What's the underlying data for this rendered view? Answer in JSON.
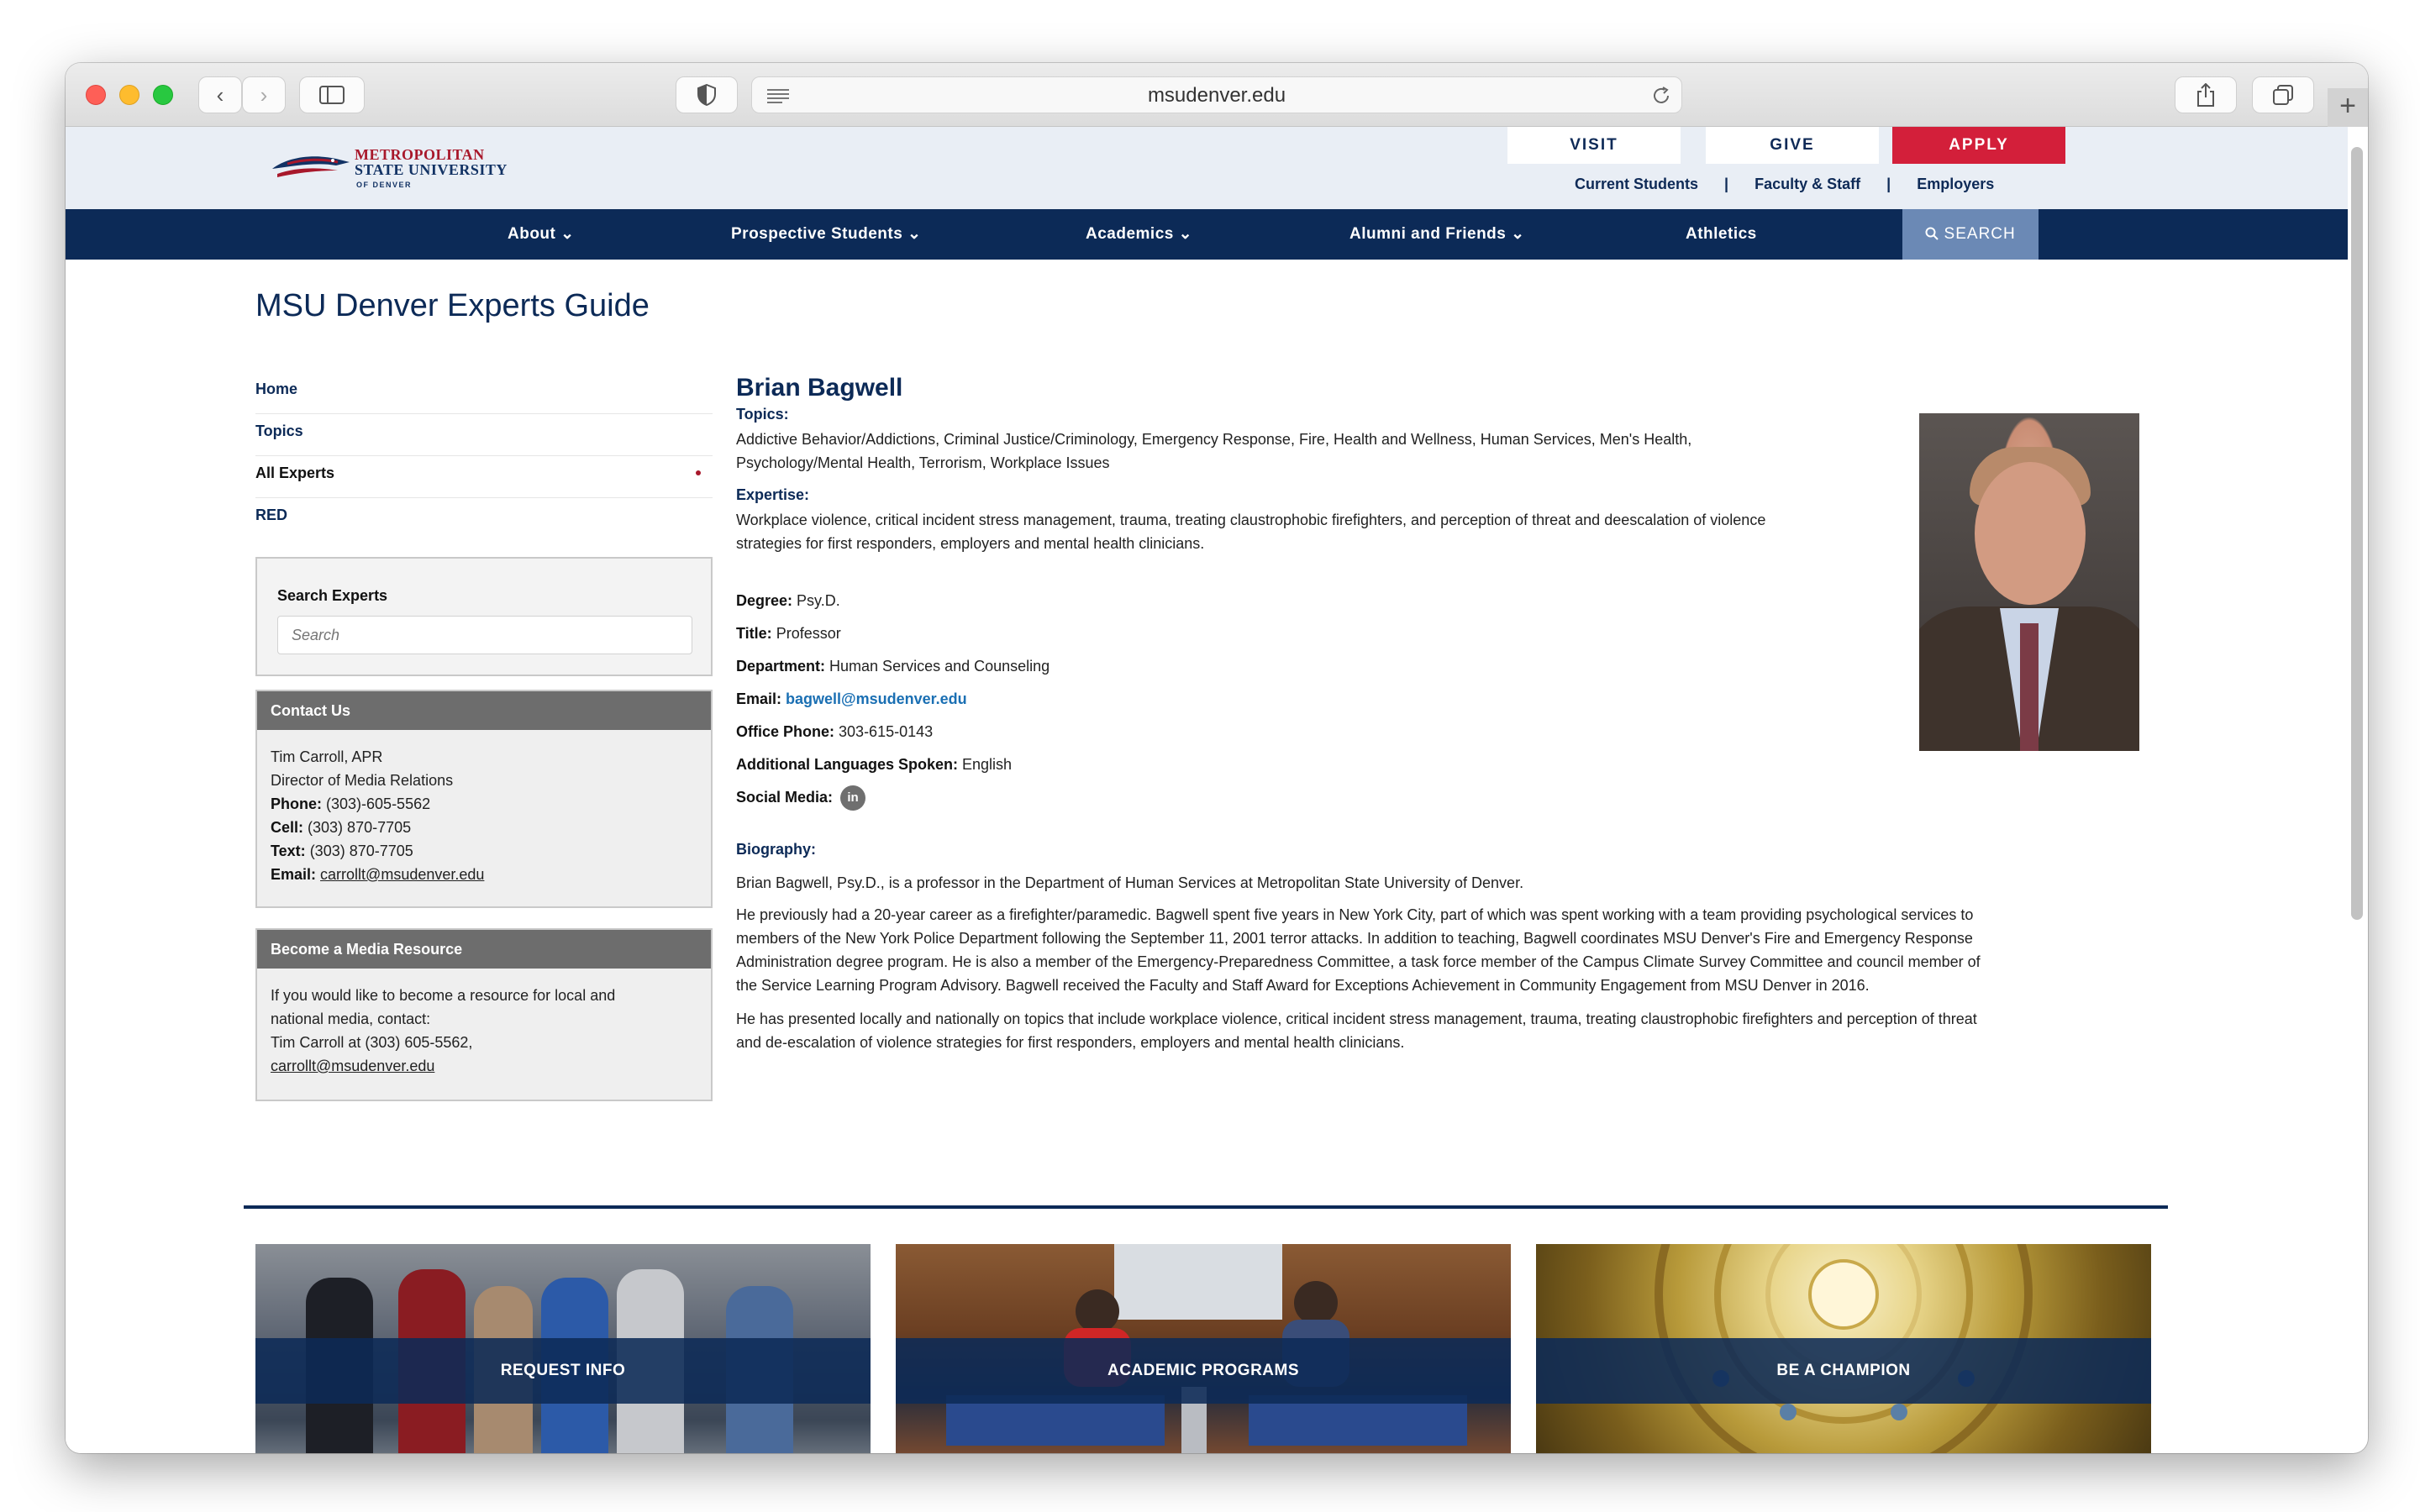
{
  "browser": {
    "url": "msudenver.edu"
  },
  "logo": {
    "line1": "Metropolitan",
    "line2": "State University",
    "line3": "of Denver"
  },
  "topbar": {
    "buttons": [
      {
        "label": "VISIT"
      },
      {
        "label": "GIVE"
      },
      {
        "label": "APPLY"
      }
    ],
    "links": [
      "Current Students",
      "Faculty & Staff",
      "Employers"
    ],
    "separator": "|"
  },
  "nav": {
    "items": [
      {
        "label": "About ⌄"
      },
      {
        "label": "Prospective Students ⌄"
      },
      {
        "label": "Academics ⌄"
      },
      {
        "label": "Alumni and Friends ⌄"
      },
      {
        "label": "Athletics"
      }
    ],
    "search_label": "SEARCH"
  },
  "page_title": "MSU Denver Experts Guide",
  "sidebar": {
    "items": [
      {
        "label": "Home"
      },
      {
        "label": "Topics"
      },
      {
        "label": "All Experts"
      },
      {
        "label": "RED"
      }
    ],
    "search": {
      "label": "Search Experts",
      "placeholder": "Search"
    },
    "contact": {
      "title": "Contact Us",
      "name": "Tim Carroll, APR",
      "role": "Director of Media Relations",
      "phone_label": "Phone:",
      "phone": "(303)-605-5562",
      "cell_label": "Cell:",
      "cell": "(303) 870-7705",
      "text_label": "Text:",
      "text": "(303) 870-7705",
      "email_label": "Email:",
      "email": "carrollt@msudenver.edu"
    },
    "media": {
      "title": "Become a Media Resource",
      "line1": "If you would like to become a resource for local and",
      "line2": "national media, contact:",
      "line3": "Tim Carroll at (303) 605-5562,",
      "email": "carrollt@msudenver.edu"
    }
  },
  "expert": {
    "name": "Brian Bagwell",
    "topics_label": "Topics:",
    "topics_line1": "Addictive Behavior/Addictions, Criminal Justice/Criminology, Emergency Response, Fire, Health and Wellness, Human Services, Men's Health,",
    "topics_line2": "Psychology/Mental Health, Terrorism, Workplace Issues",
    "expertise_label": "Expertise:",
    "expertise_line1": "Workplace violence, critical incident stress management, trauma, treating claustrophobic firefighters, and perception of threat and deescalation of violence",
    "expertise_line2": "strategies for first responders, employers and mental health clinicians.",
    "degree_label": "Degree:",
    "degree": "Psy.D.",
    "title_label": "Title:",
    "title": "Professor",
    "department_label": "Department:",
    "department": "Human Services and Counseling",
    "email_label": "Email:",
    "email": "bagwell@msudenver.edu",
    "phone_label": "Office Phone:",
    "phone": "303-615-0143",
    "languages_label": "Additional Languages Spoken:",
    "languages": "English",
    "social_label": "Social Media:",
    "social_icon": "in",
    "bio_label": "Biography:",
    "bio_p1": "Brian Bagwell, Psy.D., is a professor in the Department of Human Services at Metropolitan State University of Denver.",
    "bio_p2_l1": "He previously had a 20-year career as a firefighter/paramedic. Bagwell spent five years in New York City, part of which was spent working with a team providing psychological services to",
    "bio_p2_l2": "members of the New York Police Department following the September 11, 2001 terror attacks. In addition to teaching, Bagwell coordinates MSU Denver's Fire and Emergency Response",
    "bio_p2_l3": "Administration degree program. He is also a member of the Emergency-Preparedness Committee, a task force member of the Campus Climate Survey Committee and council member of",
    "bio_p2_l4": "the Service Learning Program Advisory. Bagwell received the Faculty and Staff Award for Exceptions Achievement in Community Engagement from MSU Denver in 2016.",
    "bio_p3_l1": "He has presented locally and nationally on topics that include workplace violence, critical incident stress management, trauma, treating claustrophobic firefighters and perception of threat",
    "bio_p3_l2": "and de-escalation of violence strategies for first responders, employers and mental health clinicians."
  },
  "tiles": [
    {
      "label": "REQUEST INFO"
    },
    {
      "label": "ACADEMIC PROGRAMS"
    },
    {
      "label": "BE A CHAMPION"
    }
  ],
  "colors": {
    "navy": "#0c2a57",
    "red": "#d31f3a",
    "search_blue": "#6b89b5"
  }
}
